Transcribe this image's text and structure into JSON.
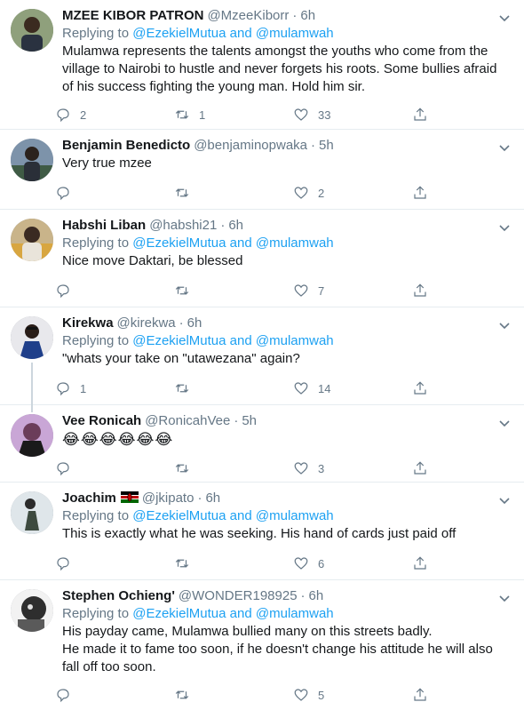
{
  "replying_label": "Replying to",
  "replying_and": "and",
  "tweets": [
    {
      "name": "MZEE KIBOR PATRON",
      "handle": "@MzeeKiborr",
      "time": "6h",
      "reply_to": [
        "@EzekielMutua",
        "@mulamwah"
      ],
      "text": "Mulamwa represents the talents amongst the youths who come from the village to Nairobi to hustle and never forgets his roots. Some bullies afraid of his success fighting the young man. Hold him sir.",
      "replies": "2",
      "retweets": "1",
      "likes": "33",
      "avatar_color": "#6b7a5c"
    },
    {
      "name": "Benjamin Benedicto",
      "handle": "@benjaminopwaka",
      "time": "5h",
      "reply_to": [],
      "text": "Very true mzee",
      "replies": "",
      "retweets": "",
      "likes": "2",
      "avatar_color": "#4e6a8a"
    },
    {
      "name": "Habshi Liban",
      "handle": "@habshi21",
      "time": "6h",
      "reply_to": [
        "@EzekielMutua",
        "@mulamwah"
      ],
      "text": "Nice move Daktari, be blessed",
      "replies": "",
      "retweets": "",
      "likes": "7",
      "avatar_color": "#8c7a52"
    },
    {
      "name": "Kirekwa",
      "handle": "@kirekwa",
      "time": "6h",
      "reply_to": [
        "@EzekielMutua",
        "@mulamwah"
      ],
      "text": "\"whats your take on \"utawezana\" again?",
      "replies": "1",
      "retweets": "",
      "likes": "14",
      "avatar_color": "#2d3f5c"
    },
    {
      "name": "Vee Ronicah",
      "handle": "@RonicahVee",
      "time": "5h",
      "reply_to": [],
      "text": "😂😂😂😂😂😂",
      "replies": "",
      "retweets": "",
      "likes": "3",
      "avatar_color": "#9b6b9a"
    },
    {
      "name": "Joachim",
      "handle": "@jkipato",
      "time": "6h",
      "reply_to": [
        "@EzekielMutua",
        "@mulamwah"
      ],
      "text": "This is exactly what he was seeking. His hand of cards just paid off",
      "replies": "",
      "retweets": "",
      "likes": "6",
      "avatar_color": "#b8c2c9"
    },
    {
      "name": "Stephen Ochieng'",
      "handle": "@WONDER198925",
      "time": "6h",
      "reply_to": [
        "@EzekielMutua",
        "@mulamwah"
      ],
      "text": "His payday came, Mulamwa bullied many on this streets badly.\nHe made it to fame too soon, if he doesn't change his attitude he will also fall off too soon.",
      "replies": "",
      "retweets": "",
      "likes": "5",
      "avatar_color": "#3a3a3a"
    }
  ],
  "colors": {
    "link": "#1da1f2",
    "muted": "#657786",
    "border": "#e6ecf0"
  },
  "icons": [
    "reply-icon",
    "retweet-icon",
    "like-icon",
    "share-icon",
    "caret-down-icon",
    "kenya-flag-icon"
  ]
}
